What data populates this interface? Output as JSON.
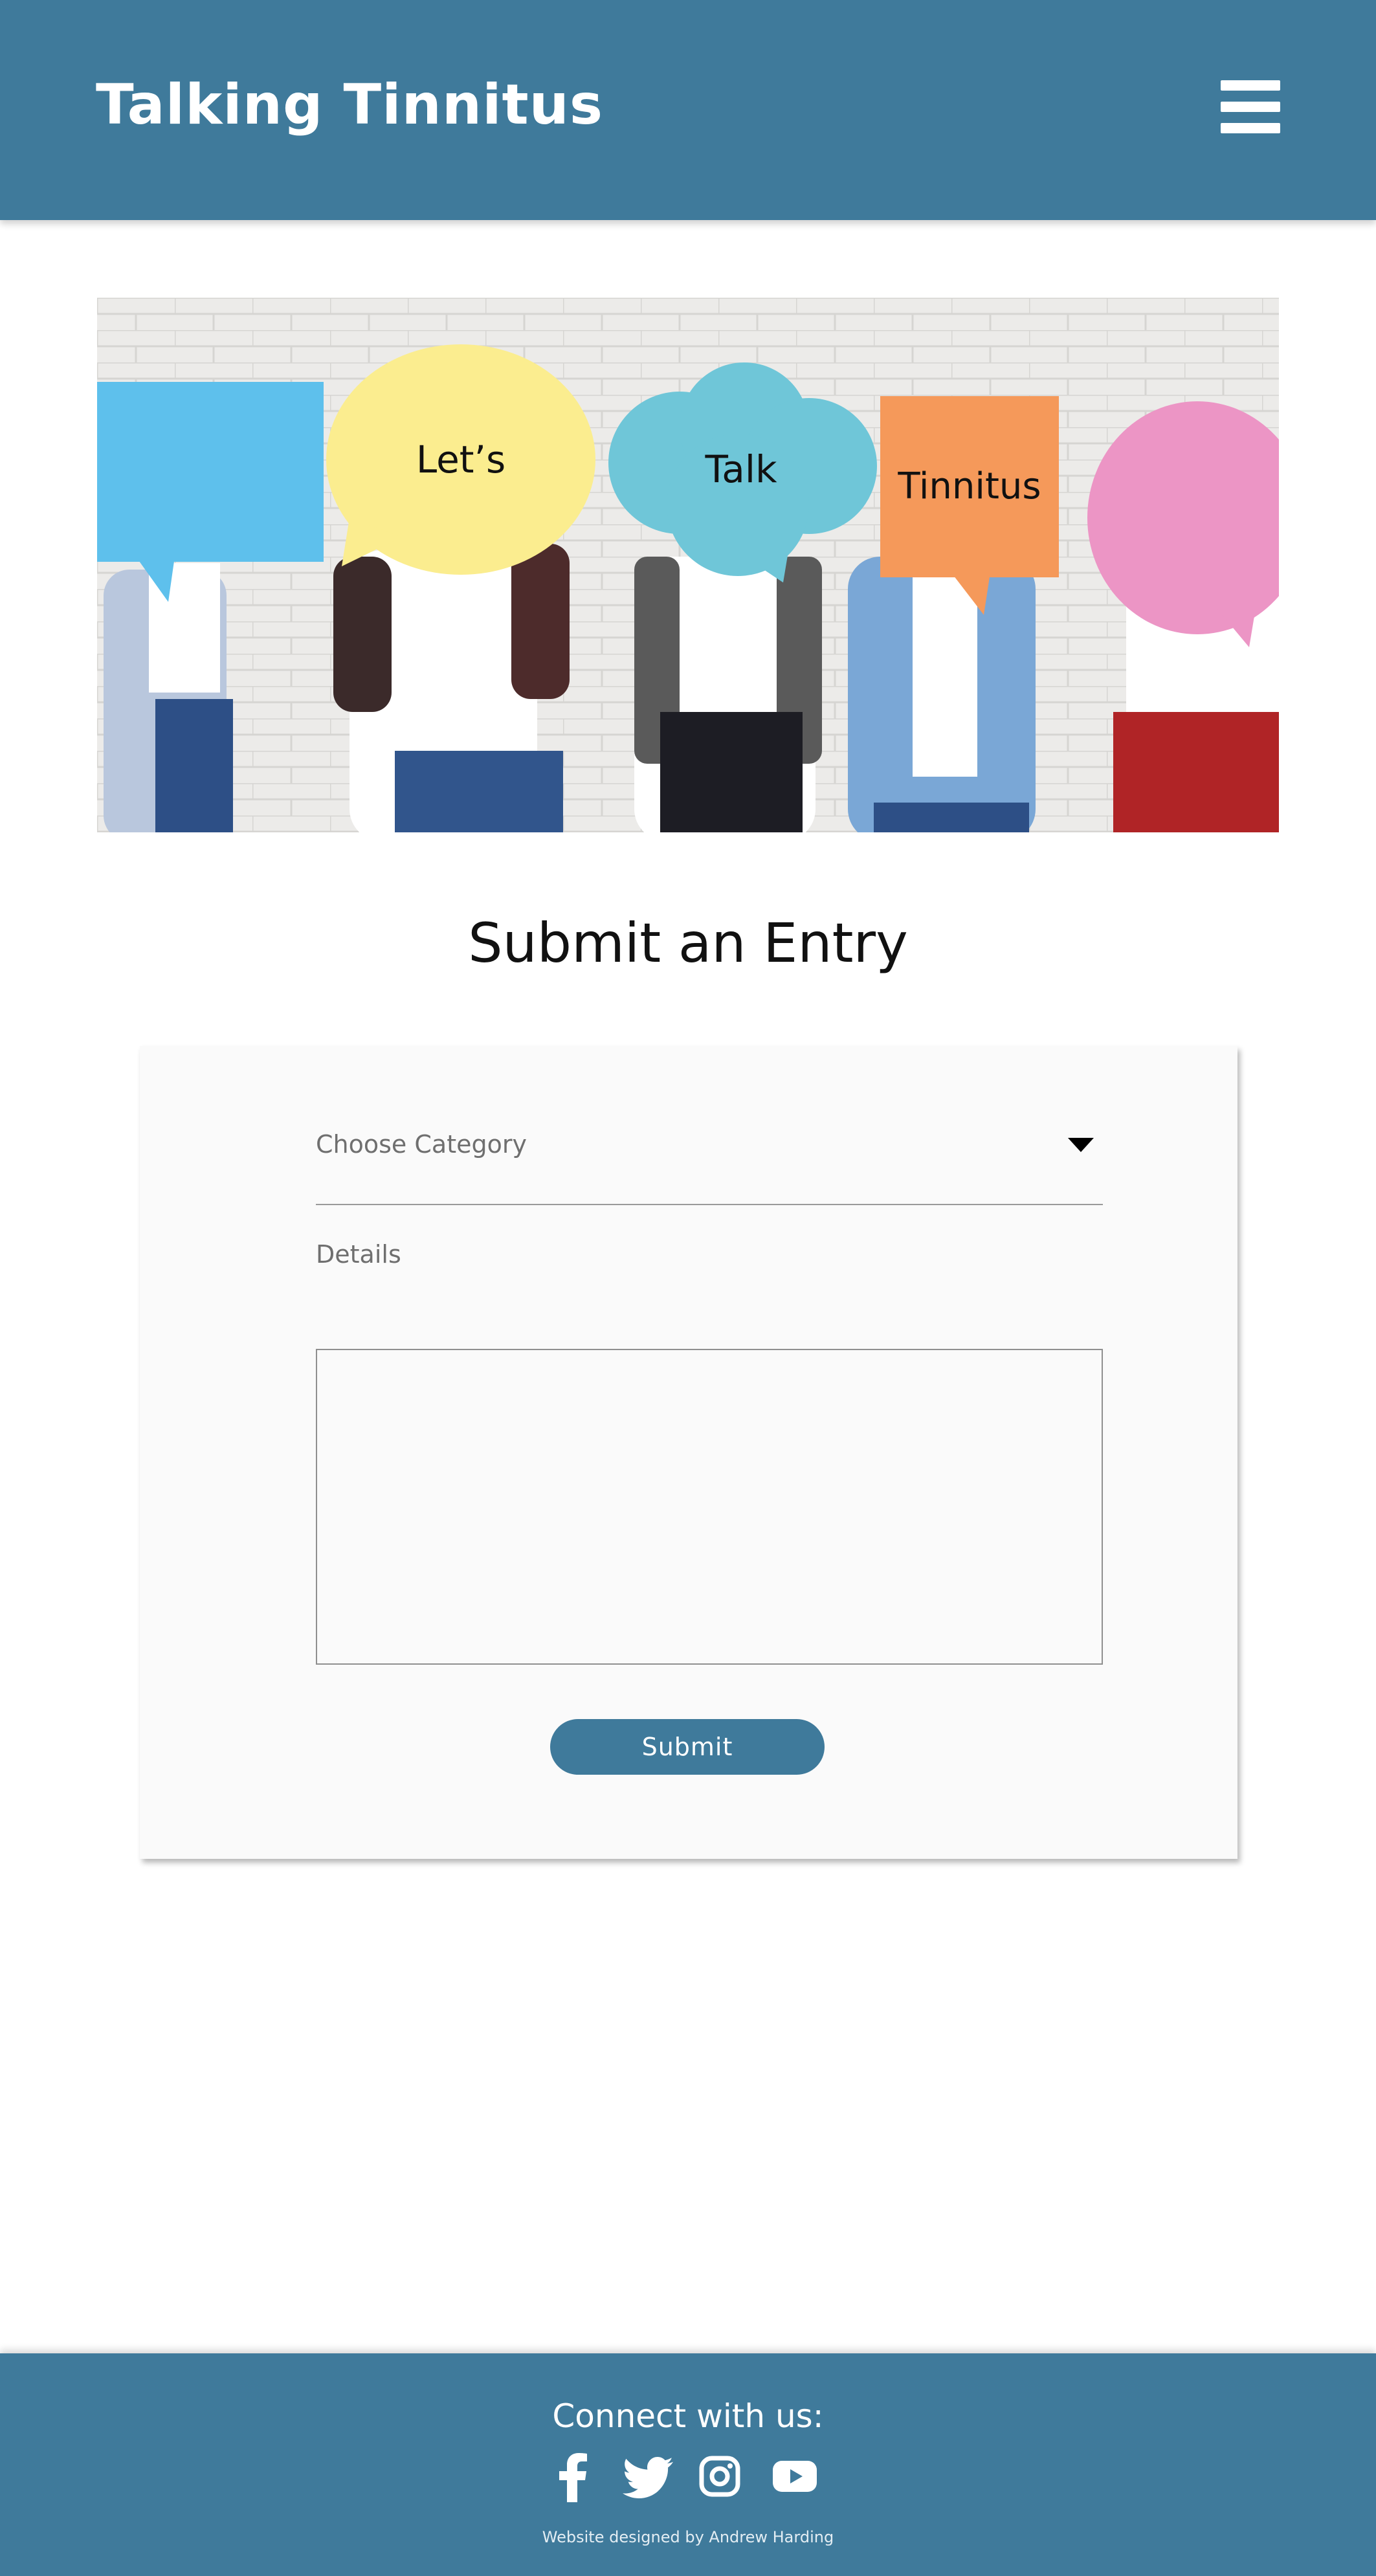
{
  "header": {
    "site_title": "Talking Tinnitus",
    "menu_icon": "hamburger-menu-icon",
    "background_color": "#3f7a9b"
  },
  "banner": {
    "bubble_texts": [
      "Let’s",
      "Talk",
      "Tinnitus"
    ]
  },
  "main": {
    "heading": "Submit an Entry"
  },
  "form": {
    "category_label": "Choose Category",
    "details_label": "Details",
    "details_value": "",
    "submit_label": "Submit"
  },
  "footer": {
    "connect_label": "Connect with us:",
    "social_icons": [
      "facebook-icon",
      "twitter-icon",
      "instagram-icon",
      "youtube-icon"
    ],
    "credit": "Website designed by Andrew Harding"
  },
  "colors": {
    "brand": "#3f7a9b",
    "card": "#fafafa"
  }
}
